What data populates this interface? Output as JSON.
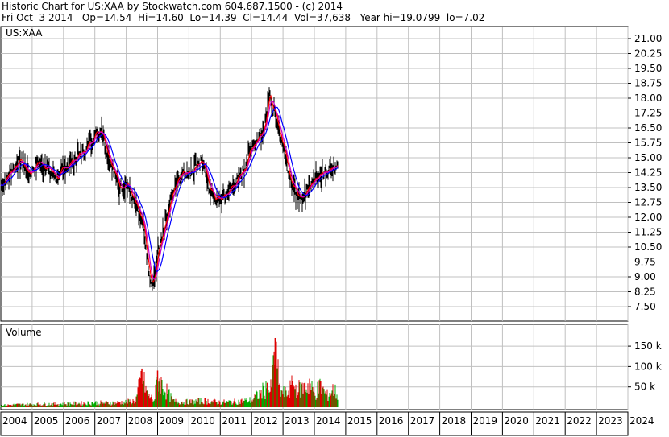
{
  "header": {
    "line1": "Historic Chart for US:XAA by Stockwatch.com 604.687.1500 - (c) 2014",
    "line2": "Fri Oct  3 2014   Op=14.54  Hi=14.60  Lo=14.39  Cl=14.44  Vol=37,638   Year hi=19.0799  lo=7.02"
  },
  "chart_data": {
    "type": "line",
    "symbol_label": "US:XAA",
    "volume_label": "Volume",
    "x_labels": [
      "2004",
      "2005",
      "2006",
      "2007",
      "2008",
      "2009",
      "2010",
      "2011",
      "2012",
      "2013",
      "2014",
      "2015",
      "2016",
      "2017",
      "2018",
      "2019",
      "2020",
      "2021",
      "2022",
      "2023",
      "2024"
    ],
    "price_ticks": [
      "21.00",
      "20.25",
      "19.50",
      "18.75",
      "18.00",
      "17.25",
      "16.50",
      "15.75",
      "15.00",
      "14.25",
      "13.50",
      "12.75",
      "12.00",
      "11.25",
      "10.50",
      "9.75",
      "9.00",
      "8.25",
      "7.50"
    ],
    "volume_ticks": [
      "150 k",
      "100 k",
      "50 k"
    ],
    "grid": true,
    "colors": {
      "price_bars": "#000000",
      "ma_short": "#ff0000",
      "ma_mid": "#cc00cc",
      "ma_long": "#0000ff",
      "volume_up": "#00aa00",
      "volume_down": "#dd0000",
      "grid": "#c0c0c0"
    },
    "series": [
      {
        "x": [
          2004.0,
          2004.3,
          2004.6,
          2004.9,
          2005.2,
          2005.5,
          2005.8,
          2006.1,
          2006.4,
          2006.7,
          2007.0,
          2007.2,
          2007.4,
          2007.6,
          2007.8,
          2008.0,
          2008.2,
          2008.4,
          2008.55,
          2008.7,
          2008.8,
          2008.9,
          2009.0,
          2009.2,
          2009.4,
          2009.6,
          2009.8,
          2010.0,
          2010.2,
          2010.4,
          2010.6,
          2010.8,
          2011.0,
          2011.2,
          2011.4,
          2011.6,
          2011.8,
          2012.0,
          2012.2,
          2012.4,
          2012.55,
          2012.7,
          2012.85,
          2013.0,
          2013.15,
          2013.3,
          2013.5,
          2013.7,
          2013.85,
          2014.0,
          2014.2,
          2014.4,
          2014.6,
          2014.75
        ],
        "values": [
          13.6,
          14.3,
          14.9,
          14.2,
          14.8,
          14.5,
          14.0,
          14.6,
          15.0,
          15.4,
          16.2,
          16.5,
          15.3,
          14.3,
          13.5,
          13.8,
          13.0,
          12.2,
          11.5,
          9.5,
          8.5,
          9.0,
          10.2,
          11.5,
          12.8,
          13.8,
          14.4,
          14.2,
          14.6,
          14.9,
          13.8,
          13.0,
          12.9,
          13.2,
          13.6,
          14.0,
          14.6,
          15.6,
          16.0,
          16.6,
          18.2,
          17.3,
          16.6,
          15.6,
          14.6,
          13.6,
          13.2,
          13.1,
          13.6,
          13.9,
          14.2,
          14.4,
          14.6,
          14.5
        ]
      }
    ],
    "volume": {
      "x": [
        2004.0,
        2004.5,
        2005.0,
        2005.5,
        2006.0,
        2006.5,
        2007.0,
        2007.5,
        2008.0,
        2008.3,
        2008.5,
        2008.7,
        2008.9,
        2009.0,
        2009.5,
        2010.0,
        2010.5,
        2011.0,
        2011.5,
        2012.0,
        2012.5,
        2012.6,
        2012.75,
        2012.9,
        2013.1,
        2013.3,
        2013.5,
        2013.7,
        2013.85,
        2014.0,
        2014.2,
        2014.4,
        2014.6,
        2014.75
      ],
      "values": [
        6,
        8,
        9,
        10,
        11,
        12,
        14,
        13,
        16,
        20,
        95,
        35,
        22,
        90,
        18,
        16,
        20,
        15,
        17,
        22,
        60,
        45,
        170,
        50,
        40,
        65,
        55,
        60,
        70,
        40,
        65,
        35,
        55,
        38
      ]
    }
  }
}
